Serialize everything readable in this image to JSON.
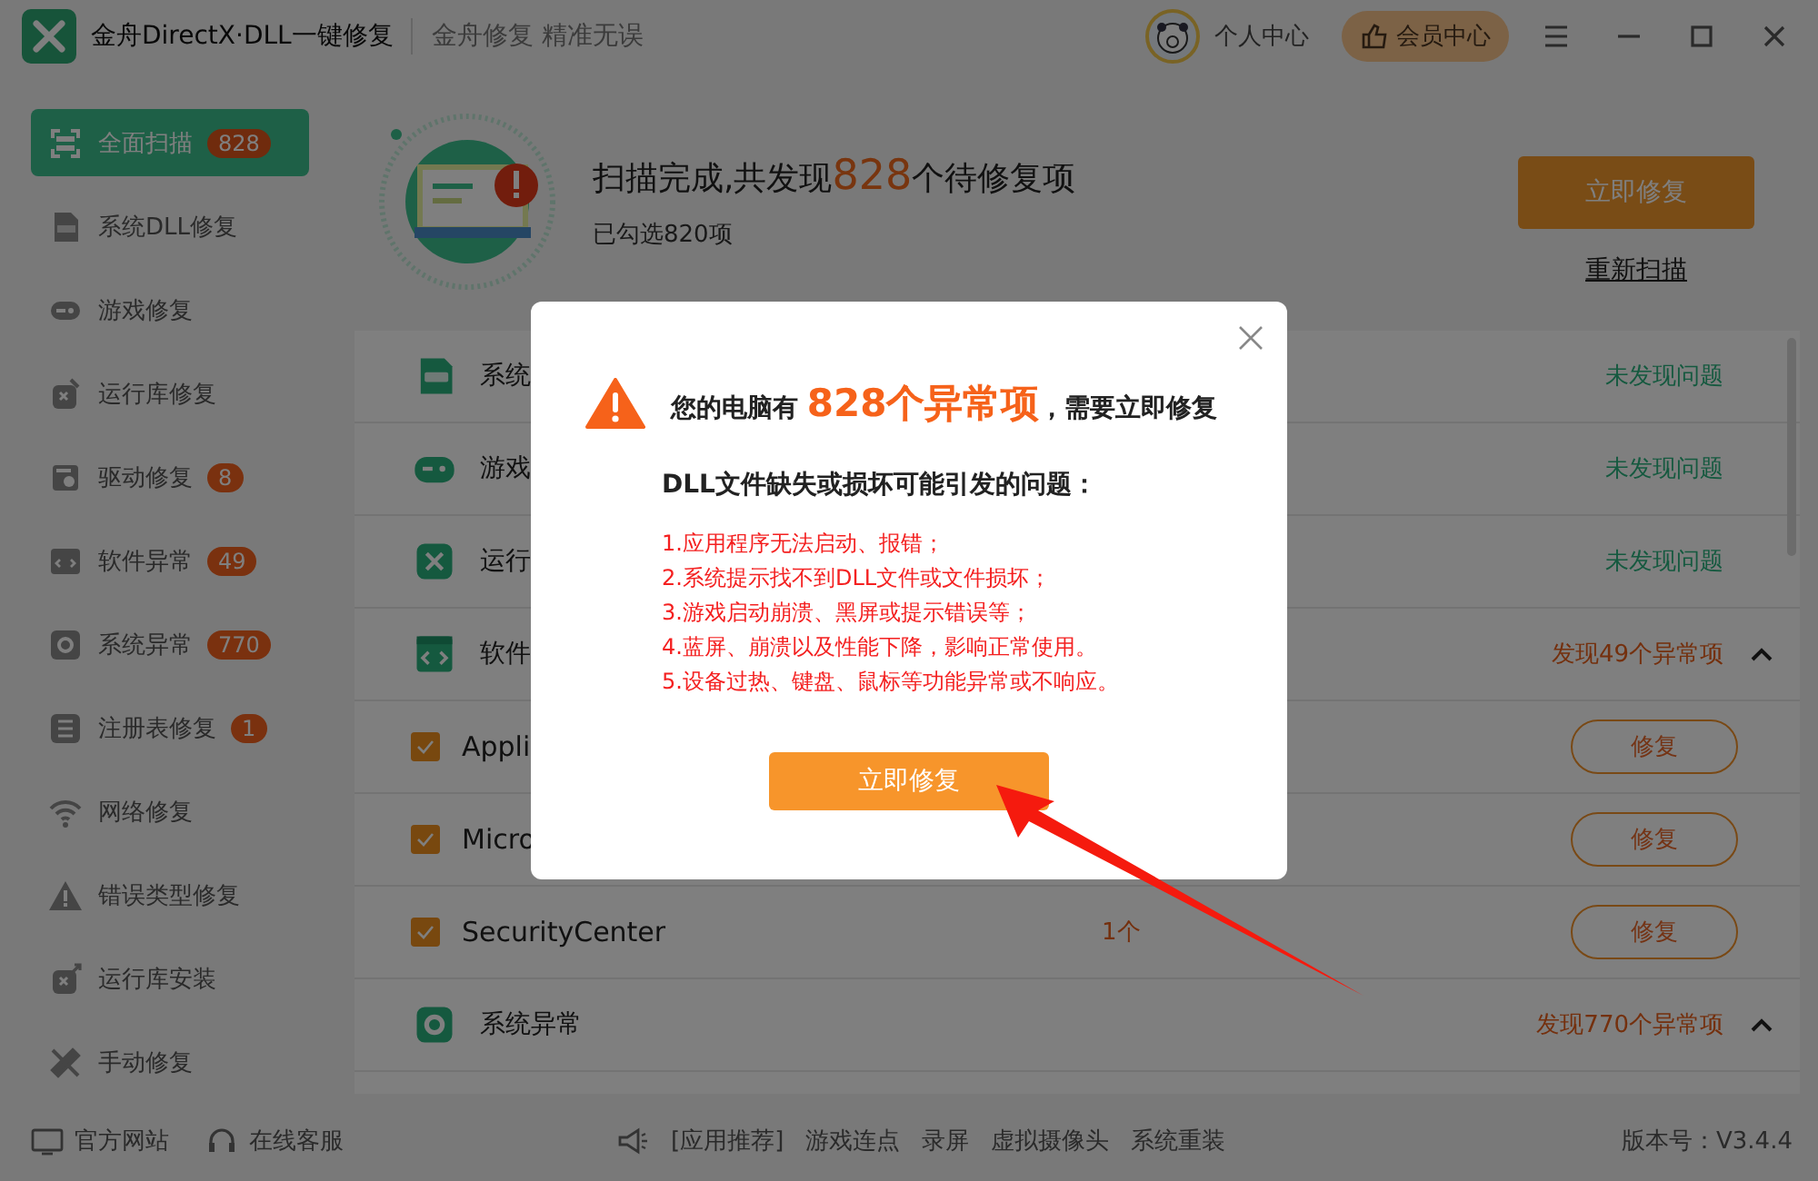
{
  "window": {
    "title": "金舟DirectX·DLL一键修复",
    "slogan": "金舟修复 精准无误",
    "user": "个人中心",
    "vip": "会员中心"
  },
  "sidebar": {
    "items": [
      {
        "label": "全面扫描",
        "badge": "828",
        "selected": true
      },
      {
        "label": "系统DLL修复",
        "selected": false
      },
      {
        "label": "游戏修复",
        "selected": false
      },
      {
        "label": "运行库修复",
        "selected": false
      },
      {
        "label": "驱动修复",
        "badge": "8",
        "selected": false
      },
      {
        "label": "软件异常",
        "badge": "49",
        "selected": false
      },
      {
        "label": "系统异常",
        "badge": "770",
        "selected": false
      },
      {
        "label": "注册表修复",
        "badge": "1",
        "selected": false
      },
      {
        "label": "网络修复",
        "selected": false
      },
      {
        "label": "错误类型修复",
        "selected": false
      },
      {
        "label": "运行库安装",
        "selected": false
      },
      {
        "label": "手动修复",
        "selected": false
      }
    ]
  },
  "summary": {
    "title": "扫描完成,共发现**828**个待修复项",
    "subtitle": "已勾选820项",
    "fix_button": "立即修复",
    "rescan_link": "重新扫描"
  },
  "list": {
    "rows": [
      {
        "kind": "category",
        "label": "系统",
        "status": "未发现问题",
        "found": false
      },
      {
        "kind": "category",
        "label": "游戏",
        "status": "未发现问题",
        "found": false
      },
      {
        "kind": "category",
        "label": "运行",
        "status": "未发现问题",
        "found": false
      },
      {
        "kind": "category",
        "label": "软件",
        "status": "发现49个异常项",
        "found": true,
        "expanded": true
      },
      {
        "kind": "item",
        "name": "Appli",
        "checked": true,
        "button": "修复"
      },
      {
        "kind": "item",
        "name": "Micro",
        "checked": true,
        "button": "修复"
      },
      {
        "kind": "item",
        "name": "SecurityCenter",
        "checked": true,
        "count": "1个",
        "button": "修复"
      },
      {
        "kind": "category",
        "label": "系统异常",
        "status": "发现770个异常项",
        "found": true,
        "expanded": true
      }
    ]
  },
  "footer": {
    "left": [
      "官方网站",
      "在线客服"
    ],
    "links": [
      "[应用推荐]",
      "游戏连点",
      "录屏",
      "虚拟摄像头",
      "系统重装"
    ],
    "version": "版本号：V3.4.4"
  },
  "dialog": {
    "title": "您的电脑有 **828个异常项**，需要立即修复",
    "heading": "DLL文件缺失或损坏可能引发的问题：",
    "problems": [
      "1.应用程序无法启动、报错；",
      "2.系统提示找不到DLL文件或文件损坏；",
      "3.游戏启动崩溃、黑屏或提示错误等；",
      "4.蓝屏、崩溃以及性能下降，影响正常使用。",
      "5.设备过热、键盘、鼠标等功能异常或不响应。"
    ],
    "button": "立即修复"
  }
}
